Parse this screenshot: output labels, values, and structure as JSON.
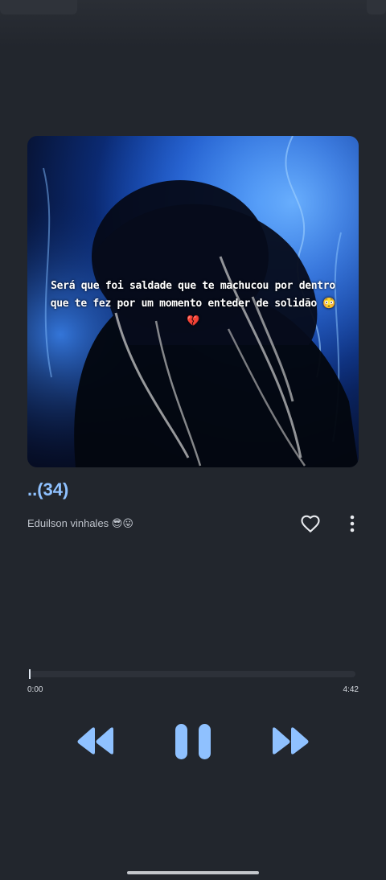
{
  "artwork": {
    "caption": "Será que foi saldade que te machucou por dentro\nque te fez por um momento enteder de solidão 😳\n💔"
  },
  "track": {
    "title": "..(34)",
    "artist": "Eduilson vinhales 😎😛"
  },
  "progress": {
    "current": "0:00",
    "total": "4:42",
    "fraction": 0.0
  },
  "controls": {
    "rewind_icon": "rewind-icon",
    "pause_icon": "pause-icon",
    "forward_icon": "fast-forward-icon",
    "like_icon": "heart-outline-icon",
    "more_icon": "more-vertical-icon"
  },
  "colors": {
    "background": "#22262d",
    "accent": "#8fc1ff",
    "text_secondary": "#bfc4cc"
  }
}
